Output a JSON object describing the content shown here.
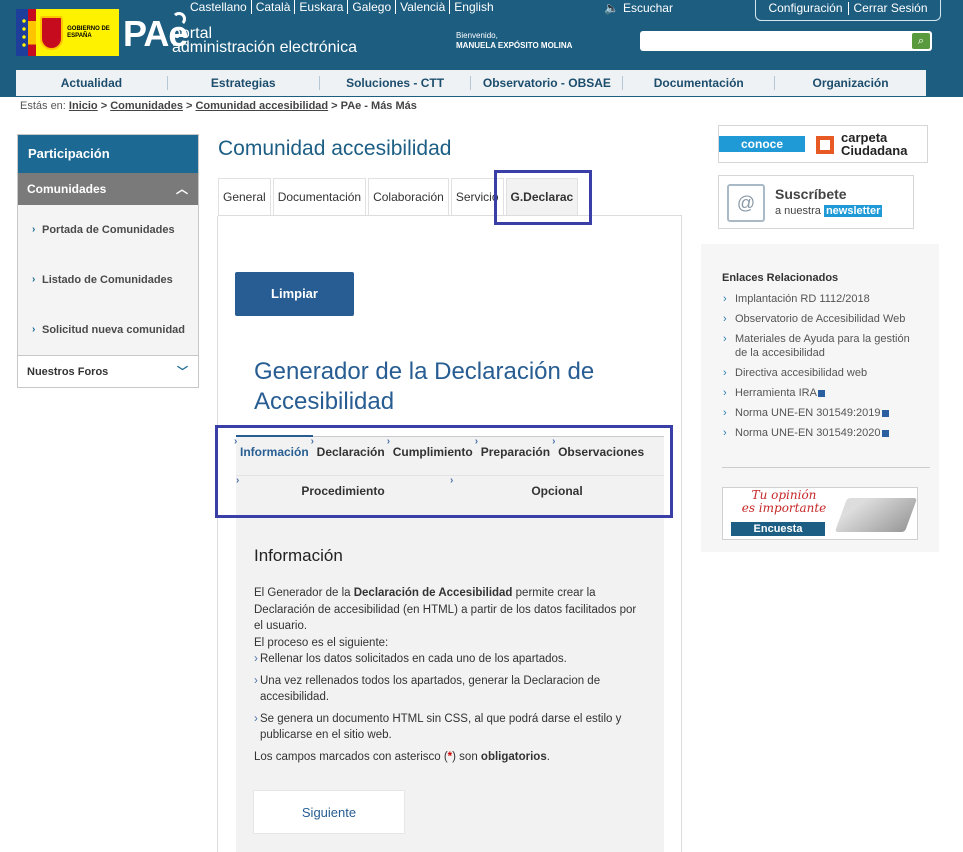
{
  "header": {
    "languages": [
      "Castellano",
      "Català",
      "Euskara",
      "Galego",
      "Valencià",
      "English"
    ],
    "listen": "Escuchar",
    "user_links": [
      "Configuración",
      "Cerrar Sesión"
    ],
    "gob_text": "GOBIERNO DE ESPAÑA",
    "brand_pae": "PAe",
    "brand_portal": "portal",
    "brand_sub": "administración electrónica",
    "welcome": "Bienvenido,",
    "user_name": "MANUELA EXPÓSITO MOLINA",
    "search_placeholder": ""
  },
  "nav": [
    "Actualidad",
    "Estrategias",
    "Soluciones - CTT",
    "Observatorio - OBSAE",
    "Documentación",
    "Organización"
  ],
  "breadcrumb": {
    "label": "Estás en:",
    "links": [
      "Inicio",
      "Comunidades",
      "Comunidad accesibilidad"
    ],
    "current": "PAe - Más Más"
  },
  "sidebar": {
    "header": "Participación",
    "section": "Comunidades",
    "items": [
      "Portada de Comunidades",
      "Listado de Comunidades",
      "Solicitud nueva comunidad"
    ],
    "footer": "Nuestros Foros"
  },
  "main": {
    "title": "Comunidad accesibilidad",
    "tabs": [
      "General",
      "Documentación",
      "Colaboración",
      "Servicio",
      "G.Declarac"
    ],
    "active_tab": "G.Declarac",
    "clear_button": "Limpiar",
    "generator_title": "Generador de la Declaración de Accesibilidad",
    "subtabs_row1": [
      "Información",
      "Declaración",
      "Cumplimiento",
      "Preparación",
      "Observaciones"
    ],
    "subtabs_row2": [
      "Procedimiento",
      "Opcional"
    ],
    "info": {
      "title": "Información",
      "p1_a": "El Generador de la ",
      "p1_b": "Declaración de Accesibilidad",
      "p1_c": " permite crear la Declaración de accesibilidad (en HTML) a partir de los datos facilitados por el usuario.",
      "p2": "El proceso es el siguiente:",
      "bullets": [
        "Rellenar los datos solicitados en cada uno de los apartados.",
        "Una vez rellenados todos los apartados, generar la Declaracion de accesibilidad.",
        "Se genera un documento HTML sin CSS, al que podrá darse el estilo y publicarse en el sitio web."
      ],
      "req_a": "Los campos marcados con asterisco (",
      "req_star": "*",
      "req_b": ") son ",
      "req_c": "obligatorios",
      "req_d": "."
    },
    "next_button": "Siguiente"
  },
  "right": {
    "conoce_pill": "conoce",
    "conoce_text1": "carpeta",
    "conoce_text2": "Ciudadana",
    "subs_title": "Suscríbete",
    "subs_prefix": "a nuestra",
    "subs_highlight": "newsletter",
    "related_title": "Enlaces Relacionados",
    "related_links": [
      "Implantación RD 1112/2018",
      "Observatorio de Accesibilidad Web",
      "Materiales de Ayuda para la gestión de la accesibilidad",
      "Directiva accesibilidad web",
      "Herramienta IRA",
      "Norma UNE-EN 301549:2019",
      "Norma UNE-EN 301549:2020"
    ],
    "survey_text1": "Tu opinión",
    "survey_text2": "es importante",
    "survey_button": "Encuesta"
  },
  "colors": {
    "header_bg": "#1c5d80",
    "accent": "#275d92",
    "highlight_box": "#3a3fa8"
  }
}
